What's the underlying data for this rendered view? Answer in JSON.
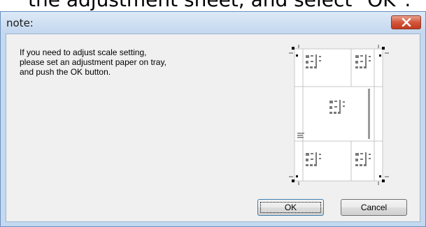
{
  "caption": "the adjustment sheet, and select \"OK\".",
  "dialog": {
    "title": "note:",
    "message_lines": [
      "If you need to adjust scale setting,",
      "please set an adjustment paper on tray,",
      "and push the OK button."
    ],
    "ok_label": "OK",
    "cancel_label": "Cancel",
    "close_icon": "close-icon",
    "illustration_icon": "adjustment-sheet-icon"
  },
  "colors": {
    "title_bar": "#c8dbf1",
    "close_button": "#d3573c",
    "client_background": "#f0f0f0"
  }
}
